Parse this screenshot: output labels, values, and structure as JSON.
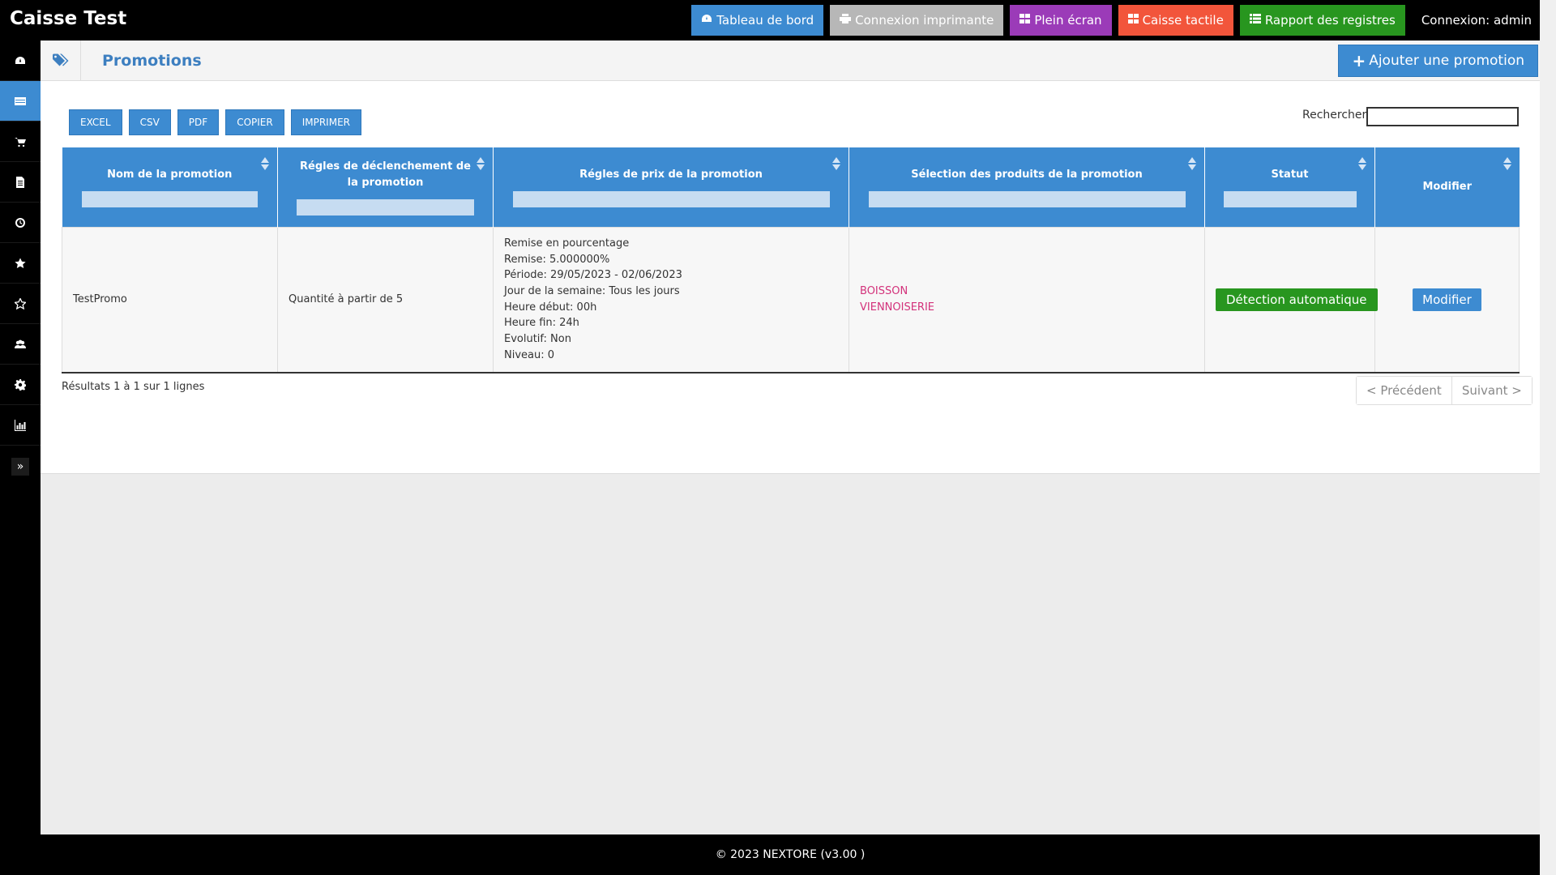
{
  "app": {
    "title": "Caisse Test",
    "login": "Connexion: admin"
  },
  "topnav": [
    {
      "label": "Tableau de bord",
      "icon": "dashboard-icon",
      "color": "#3d8bd1"
    },
    {
      "label": "Connexion imprimante",
      "icon": "printer-icon",
      "color": "#b7b7b7"
    },
    {
      "label": "Plein écran",
      "icon": "grid-icon",
      "color": "#9b3bb8"
    },
    {
      "label": "Caisse tactile",
      "icon": "grid-icon",
      "color": "#f2553b"
    },
    {
      "label": "Rapport des registres",
      "icon": "list-icon",
      "color": "#28961f"
    }
  ],
  "sidebar": {
    "items": [
      "dashboard-icon",
      "table-icon",
      "cart-icon",
      "document-icon",
      "clock-icon",
      "star-icon",
      "star-outline-icon",
      "users-icon",
      "gear-icon",
      "chart-icon"
    ],
    "active": 1,
    "expand_label": "»"
  },
  "page": {
    "title": "Promotions",
    "add_label": "Ajouter une promotion"
  },
  "export": [
    "EXCEL",
    "CSV",
    "PDF",
    "COPIER",
    "IMPRIMER"
  ],
  "search": {
    "label": "Rechercher",
    "value": ""
  },
  "table": {
    "columns": [
      "Nom de la promotion",
      "Régles de déclenchement de la promotion",
      "Régles de prix de la promotion",
      "Sélection des produits de la promotion",
      "Statut",
      "Modifier"
    ],
    "rows": [
      {
        "name": "TestPromo",
        "trigger": "Quantité à partir de 5",
        "price_rules": [
          "Remise en pourcentage",
          "Remise: 5.000000%",
          "Période: 29/05/2023 - 02/06/2023",
          "Jour de la semaine: Tous les jours",
          "Heure début: 00h",
          "Heure fin: 24h",
          "Evolutif: Non",
          "Niveau: 0"
        ],
        "products": [
          "BOISSON",
          "VIENNOISERIE"
        ],
        "status": "Détection automatique",
        "edit": "Modifier"
      }
    ]
  },
  "results": "Résultats 1 à 1 sur 1 lignes",
  "pager": {
    "prev": "< Précédent",
    "next": "Suivant >"
  },
  "footer": "© 2023 NEXTORE (v3.00 )"
}
